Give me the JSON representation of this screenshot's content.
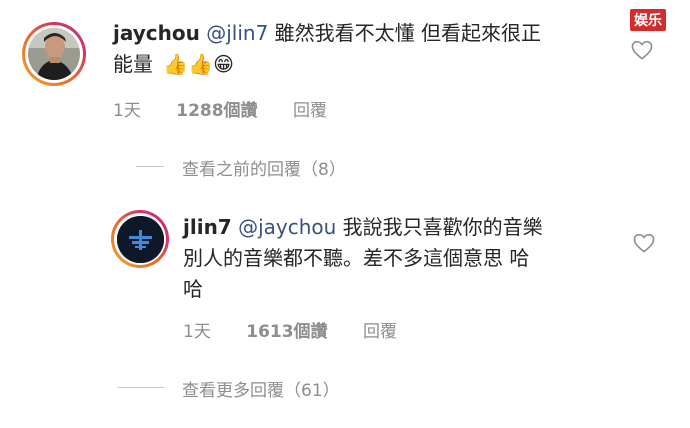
{
  "watermark": {
    "label": "娱乐"
  },
  "comment": {
    "username": "jaychou",
    "mention": "@jlin7",
    "text_line1": " 雖然我看不太懂 但看起來很正",
    "text_line2": "能量",
    "emojis": [
      "👍",
      "👍",
      "😁"
    ],
    "time": "1天",
    "likes": "1288個讚",
    "reply_label": "回覆"
  },
  "view_previous": {
    "label": "查看之前的回覆（8）"
  },
  "reply": {
    "username": "jlin7",
    "mention": "@jaychou",
    "text_line1": " 我說我只喜歡你的音樂",
    "text_line2": "別人的音樂都不聽。差不多這個意思 哈",
    "text_line3": "哈",
    "time": "1天",
    "likes": "1613個讚",
    "reply_label": "回覆"
  },
  "view_more": {
    "label": "查看更多回覆（61）"
  },
  "colors": {
    "mention": "#385185",
    "muted": "#8e8e8e",
    "ring_start": "#f5a623",
    "ring_end": "#c13584"
  }
}
